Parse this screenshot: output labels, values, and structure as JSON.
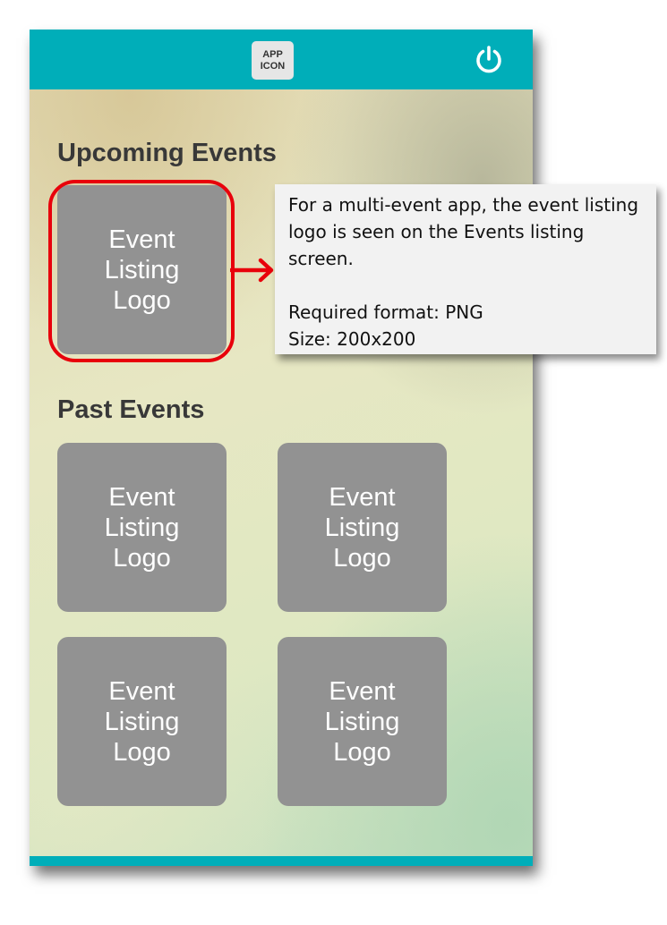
{
  "topbar": {
    "app_icon_line1": "APP",
    "app_icon_line2": "ICON",
    "power_icon": "power-icon",
    "color": "#00aeb9"
  },
  "sections": {
    "upcoming_title": "Upcoming Events",
    "past_title": "Past Events"
  },
  "tiles": {
    "upcoming": [
      {
        "label": "Event Listing Logo"
      }
    ],
    "past": [
      {
        "label": "Event Listing Logo"
      },
      {
        "label": "Event Listing Logo"
      },
      {
        "label": "Event Listing Logo"
      },
      {
        "label": "Event Listing Logo"
      }
    ]
  },
  "callout": {
    "description": "For  a multi-event app, the event listing logo is seen on the Events listing screen.",
    "format": "Required format: PNG",
    "size": "Size: 200x200",
    "highlight_color": "#e8000b"
  }
}
